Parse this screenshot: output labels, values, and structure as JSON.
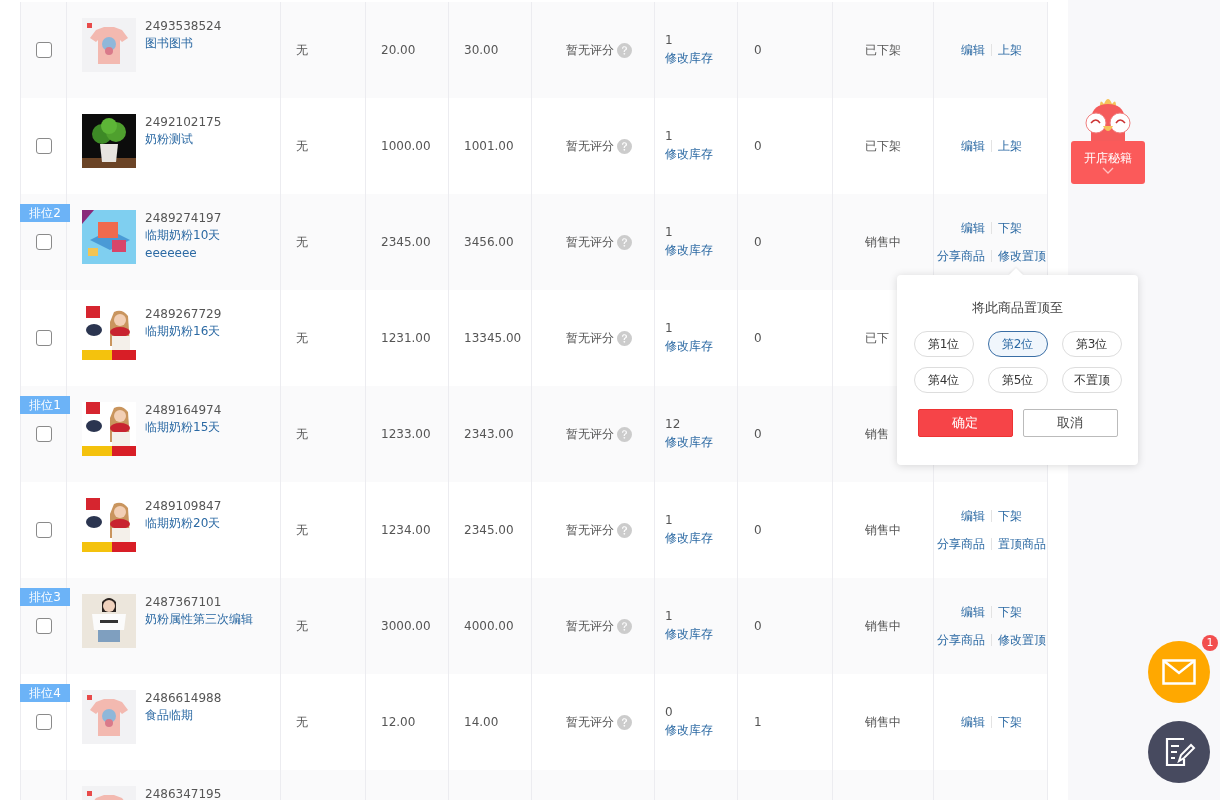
{
  "products": [
    {
      "checked": false,
      "id": "2493538524",
      "name": "图书图书",
      "column_3": "无",
      "column_4": "20.00",
      "column_5": "30.00",
      "rating": "暂无评分",
      "stock": "1",
      "stock_link": "修改库存",
      "column_8": "0",
      "status": "已下架",
      "actions": [
        {
          "left": "编辑",
          "right": "上架"
        }
      ]
    },
    {
      "checked": false,
      "id": "2492102175",
      "name": "奶粉测试",
      "column_3": "无",
      "column_4": "1000.00",
      "column_5": "1001.00",
      "rating": "暂无评分",
      "stock": "1",
      "stock_link": "修改库存",
      "column_8": "0",
      "status": "已下架",
      "actions": [
        {
          "left": "编辑",
          "right": "上架"
        }
      ]
    },
    {
      "rank": "排位2",
      "checked": false,
      "id": "2489274197",
      "name": "临期奶粉10天 eeeeeee",
      "column_3": "无",
      "column_4": "2345.00",
      "column_5": "3456.00",
      "rating": "暂无评分",
      "stock": "1",
      "stock_link": "修改库存",
      "column_8": "0",
      "status": "销售中",
      "actions": [
        {
          "left": "编辑",
          "right": "下架"
        },
        {
          "left": "分享商品",
          "right": "修改置顶"
        }
      ]
    },
    {
      "checked": false,
      "id": "2489267729",
      "name": "临期奶粉16天",
      "column_3": "无",
      "column_4": "1231.00",
      "column_5": "13345.00",
      "rating": "暂无评分",
      "stock": "1",
      "stock_link": "修改库存",
      "column_8": "0",
      "status": "已下"
    },
    {
      "rank": "排位1",
      "checked": false,
      "id": "2489164974",
      "name": "临期奶粉15天",
      "column_3": "无",
      "column_4": "1233.00",
      "column_5": "2343.00",
      "rating": "暂无评分",
      "stock": "12",
      "stock_link": "修改库存",
      "column_8": "0",
      "status": "销售"
    },
    {
      "checked": false,
      "id": "2489109847",
      "name": "临期奶粉20天",
      "column_3": "无",
      "column_4": "1234.00",
      "column_5": "2345.00",
      "rating": "暂无评分",
      "stock": "1",
      "stock_link": "修改库存",
      "column_8": "0",
      "status": "销售中",
      "actions": [
        {
          "left": "编辑",
          "right": "下架"
        },
        {
          "left": "分享商品",
          "right": "置顶商品"
        }
      ]
    },
    {
      "rank": "排位3",
      "checked": false,
      "id": "2487367101",
      "name": "奶粉属性第三次编辑",
      "column_3": "无",
      "column_4": "3000.00",
      "column_5": "4000.00",
      "rating": "暂无评分",
      "stock": "1",
      "stock_link": "修改库存",
      "column_8": "0",
      "status": "销售中",
      "actions": [
        {
          "left": "编辑",
          "right": "下架"
        },
        {
          "left": "分享商品",
          "right": "修改置顶"
        }
      ]
    },
    {
      "rank": "排位4",
      "checked": false,
      "id": "2486614988",
      "name": "食品临期",
      "column_3": "无",
      "column_4": "12.00",
      "column_5": "14.00",
      "rating": "暂无评分",
      "stock": "0",
      "stock_link": "修改库存",
      "column_8": "1",
      "status": "销售中",
      "actions": [
        {
          "left": "编辑",
          "right": "下架"
        }
      ]
    },
    {
      "id": "2486347195"
    }
  ],
  "pin_popover": {
    "title": "将此商品置顶至",
    "options": [
      {
        "label": "第1位",
        "selected": false
      },
      {
        "label": "第2位",
        "selected": true
      },
      {
        "label": "第3位",
        "selected": false
      },
      {
        "label": "第4位",
        "selected": false
      },
      {
        "label": "第5位",
        "selected": false
      },
      {
        "label": "不置顶",
        "selected": false
      }
    ],
    "confirm": "确定",
    "cancel": "取消"
  },
  "promo": {
    "label": "开店秘籍"
  },
  "messages": {
    "badge": "1"
  }
}
